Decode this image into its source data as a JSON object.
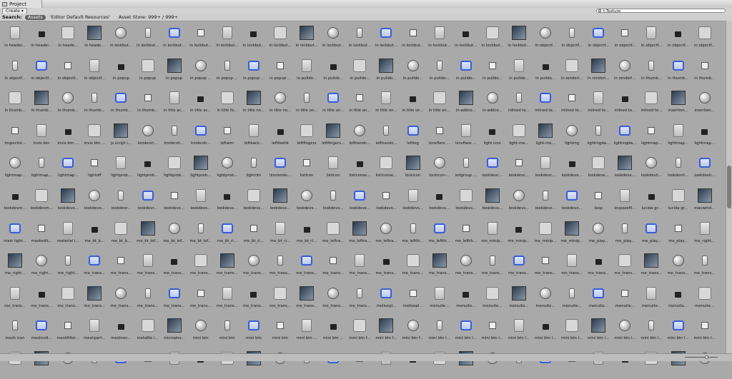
{
  "window": {
    "title": "Project"
  },
  "toolbar": {
    "create_label": "Create ▾",
    "search_value": "t:Texture"
  },
  "searchbar": {
    "label": "Search:",
    "scopes": [
      "Assets",
      "'Editor Default Resources'",
      "Asset Store: 999+ / 999+"
    ]
  },
  "rows": [
    [
      "in header...",
      "in header...",
      "in heade...",
      "in heade...",
      "in lockbut...",
      "in lockbut...",
      "in lockbut...",
      "in lockbut...",
      "in lockbut...",
      "in lockbut...",
      "in lockbut...",
      "in lockbut...",
      "in lockbut...",
      "in lockbut...",
      "in lockbut...",
      "in lockbut...",
      "in lockbut...",
      "in lockbut...",
      "in lockbut...",
      "in lockbut...",
      "in objectf...",
      "in objectf...",
      "in objectf...",
      "in objectf...",
      "in objectf...",
      "in objectf...",
      "in objectf..."
    ],
    [
      "in objectf...",
      "in objectf...",
      "in objectf...",
      "in objectf...",
      "in popup",
      "in popup",
      "in popup",
      "in popup ...",
      "in popup ...",
      "in popup ...",
      "in popup ...",
      "in pulldo...",
      "in pulldo...",
      "in pulldo...",
      "in pulldo...",
      "in pulldo...",
      "in pulldo...",
      "in pulldo...",
      "in pulldo...",
      "in pulldo...",
      "in pulldo...",
      "in renderl...",
      "in renderl...",
      "in renderl...",
      "in thumb...",
      "in thumb...",
      "in thumb..."
    ],
    [
      "in thumb...",
      "in thumb...",
      "in thumb...",
      "in thumb...",
      "in thumb...",
      "in thumb...",
      "in title ac...",
      "in title ac...",
      "in title fo...",
      "in title no...",
      "in title no...",
      "in title on...",
      "in title on...",
      "in title on...",
      "in title on...",
      "in title on...",
      "in title on...",
      "in-addco...",
      "in-addco...",
      "inlined te...",
      "inlined te...",
      "inlined te...",
      "inlined te...",
      "inlined te...",
      "inlined te...",
      "insertion...",
      "insertion..."
    ],
    [
      "inspector...",
      "invis btn",
      "invis btn ...",
      "invis btn ...",
      "js script i...",
      "knobcsh...",
      "knobcsh...",
      "knobcsh...",
      "leftarm",
      "leftback...",
      "leftfeetik",
      "leftfingers",
      "leftfingers...",
      "lefthandc...",
      "lefthandz...",
      "leftleg",
      "lensflare ...",
      "lensflare ...",
      "light icon",
      "light-me...",
      "light-me...",
      "lighting",
      "lightingda...",
      "lightingda...",
      "lightmap...",
      "lightmap...",
      "lightmap..."
    ],
    [
      "lightmap...",
      "lightmap...",
      "lightmap...",
      "lightoff",
      "lightprob...",
      "lightprob...",
      "lightprob...",
      "lightprob...",
      "lightprob...",
      "lightrim",
      "linerende...",
      "listicon",
      "listicon",
      "listiconse...",
      "listiconse...",
      "lockicon",
      "lockicon-...",
      "lodgroup ...",
      "lookdevc...",
      "lookdevc...",
      "lookdevc...",
      "lookdeve...",
      "lookdeve...",
      "lookdeve...",
      "lookdevli...",
      "lookdevli...",
      "lookdevli..."
    ],
    [
      "lookdevm...",
      "lookdevm...",
      "lookdevo...",
      "lookdevo...",
      "lookdevr...",
      "lookdevr...",
      "lookdevs...",
      "lookdevs...",
      "lookdevs...",
      "lookdevs...",
      "lookdevs...",
      "lookdevs...",
      "lookdevs...",
      "lookdevs...",
      "lookdevs...",
      "lookdevs...",
      "lookdevs...",
      "lookdevs...",
      "lookdevs...",
      "lookdevs...",
      "lookdevz...",
      "lookdevz...",
      "loop",
      "lovpassfil...",
      "lucida gr...",
      "lucida gr...",
      "macwind..."
    ],
    [
      "main light...",
      "maskedit...",
      "material i...",
      "me_bt_b...",
      "me_bt_b...",
      "me_bt_lef...",
      "me_bt_lef...",
      "me_bt_lef...",
      "me_bt_ri...",
      "me_bt_ri...",
      "me_bt_ri...",
      "me_bt_ri...",
      "me_leftra...",
      "me_leftra...",
      "me_leftra...",
      "me_leftth...",
      "me_leftth...",
      "me_leftth...",
      "me_minip...",
      "me_minip...",
      "me_minip...",
      "me_minip...",
      "me_play...",
      "me_play...",
      "me_play...",
      "me_play...",
      "me_right..."
    ],
    [
      "me_right...",
      "me_right...",
      "me_right...",
      "me_trans...",
      "me_trans...",
      "me_trans...",
      "me_trans...",
      "me_trans...",
      "me_trans...",
      "me_trans...",
      "me_trans...",
      "me_trans...",
      "me_trans...",
      "me_trans...",
      "me_trans...",
      "me_trans...",
      "me_trans...",
      "me_trans...",
      "me_trans...",
      "me_trans...",
      "me_trans...",
      "me_trans...",
      "me_trans...",
      "me_trans...",
      "me_trans...",
      "me_trans...",
      "me_trans..."
    ],
    [
      "me_trans...",
      "me_trans...",
      "me_trans...",
      "me_trans...",
      "me_trans...",
      "me_trans...",
      "me_trans...",
      "me_trans...",
      "me_trans...",
      "me_trans...",
      "me_trans...",
      "me_trans...",
      "me_trans...",
      "me_trans...",
      "melivepl...",
      "melivepl...",
      "menuite...",
      "menuite...",
      "menuite...",
      "menuite...",
      "menuite...",
      "menuite...",
      "menuite...",
      "menuite...",
      "menuite...",
      "menuite...",
      "menuite..."
    ],
    [
      "mesh icon",
      "meshcoll...",
      "meshfilter...",
      "meshpart...",
      "meshren...",
      "metafile i...",
      "micropho...",
      "mini btn",
      "mini btn",
      "mini btn",
      "mini btn",
      "mini btn ...",
      "mini btn ...",
      "mini btn f...",
      "mini btn f...",
      "mini btn f...",
      "mini btn l...",
      "mini btn l...",
      "mini btn l...",
      "mini btn l...",
      "mini btn l...",
      "mini btn l...",
      "mini btn l...",
      "mini btn l...",
      "mini btn l...",
      "mini btn l...",
      "mini btn l..."
    ],
    [
      "",
      "",
      "",
      "",
      "",
      "",
      "",
      "",
      "",
      "",
      "",
      "",
      "",
      "",
      "",
      "",
      "",
      "",
      "",
      "",
      "",
      "",
      "",
      "",
      "",
      "",
      ""
    ]
  ]
}
